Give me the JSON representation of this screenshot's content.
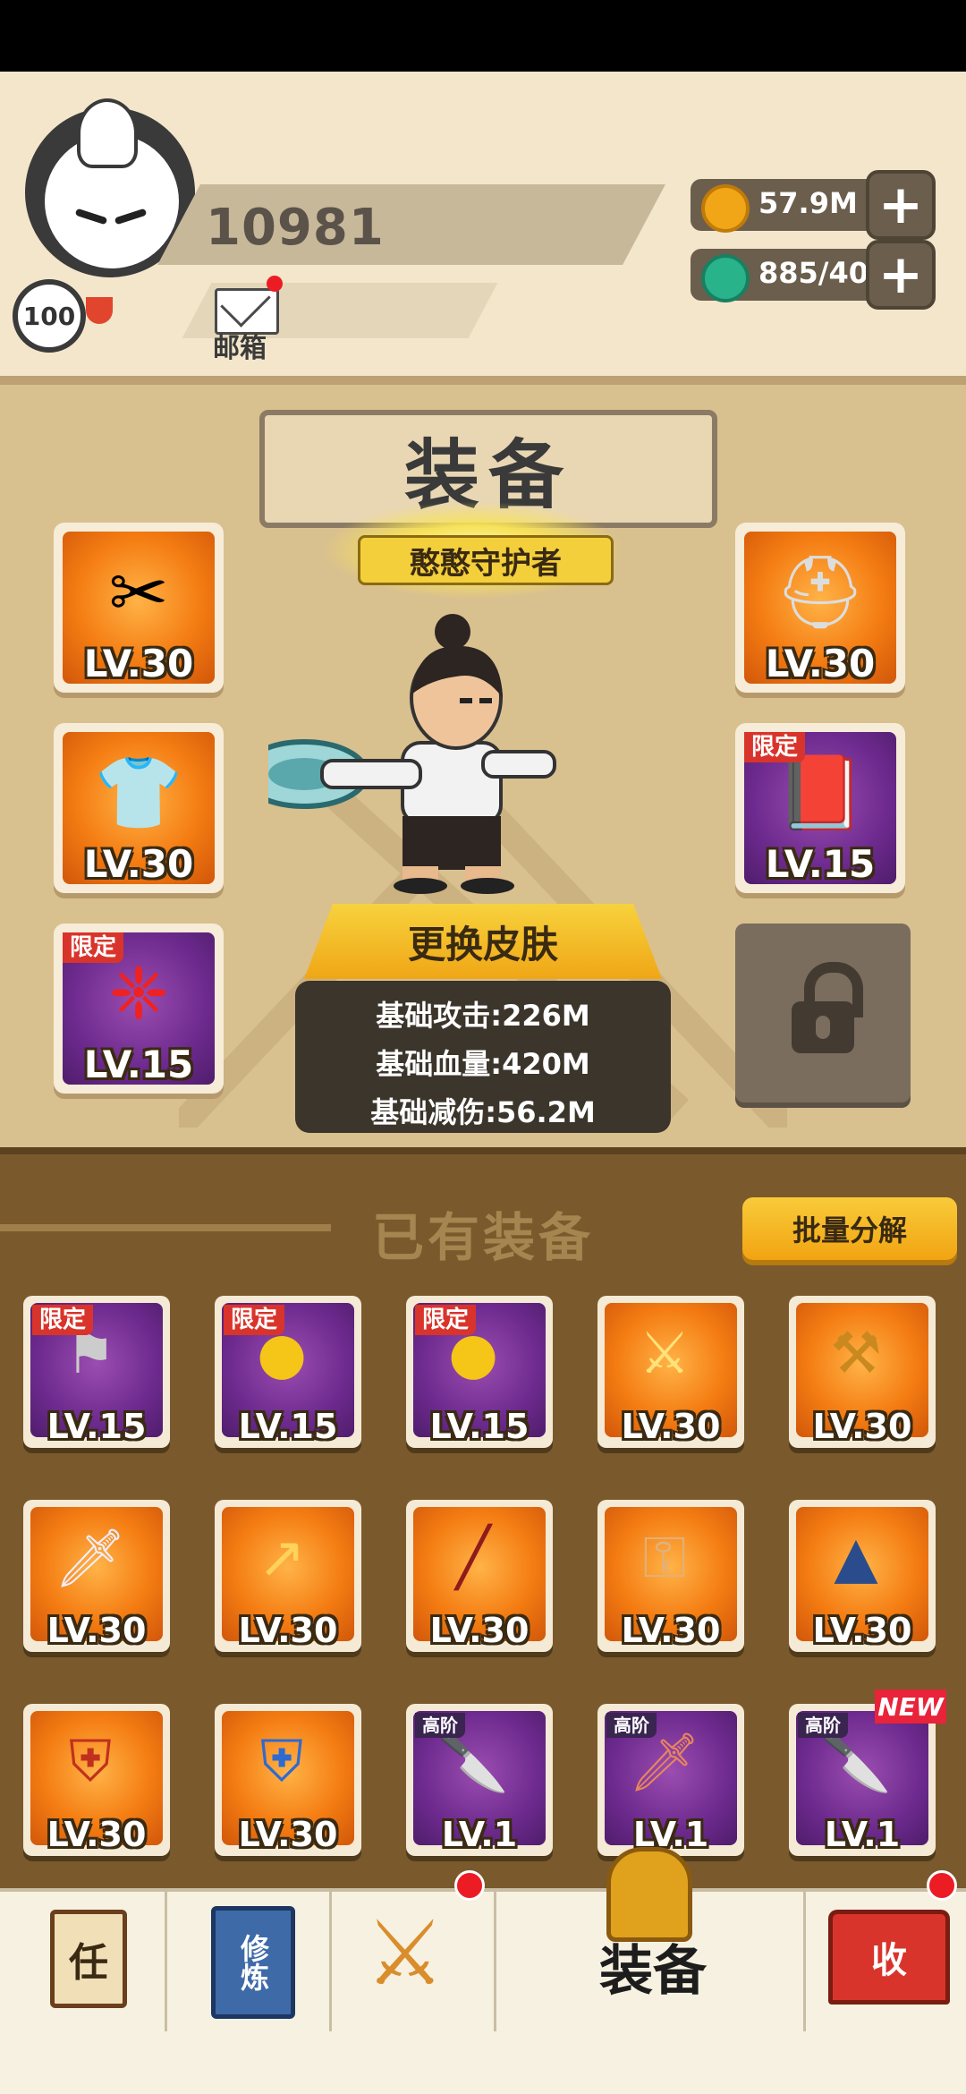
{
  "player": {
    "level": "100",
    "score": "10981",
    "mail_label": "邮箱"
  },
  "resources": [
    {
      "icon": "gold-coin-icon",
      "value": "57.9M",
      "color": "#f0a616"
    },
    {
      "icon": "jade-gem-icon",
      "value": "885/40",
      "color": "#28b38a"
    }
  ],
  "equipment": {
    "title": "装备",
    "character_title": "憨憨守护者",
    "change_skin_label": "更换皮肤",
    "stats": [
      "基础攻击:226M",
      "基础血量:420M",
      "基础减伤:56.2M"
    ],
    "slots_left": [
      {
        "icon": "scissors-icon",
        "level": "LV.30",
        "rarity": "orange",
        "tag": ""
      },
      {
        "icon": "hoodie-icon",
        "level": "LV.30",
        "rarity": "orange",
        "tag": ""
      },
      {
        "icon": "chinese-knot-icon",
        "level": "LV.15",
        "rarity": "purple",
        "tag": "限定"
      }
    ],
    "slots_right": [
      {
        "icon": "helmet-icon",
        "level": "LV.30",
        "rarity": "orange",
        "tag": ""
      },
      {
        "icon": "book-icon",
        "level": "LV.15",
        "rarity": "purple",
        "tag": "限定"
      }
    ]
  },
  "owned": {
    "title": "已有装备",
    "batch_button": "批量分解",
    "items": [
      {
        "icon": "banner-icon",
        "level": "LV.15",
        "rarity": "purple",
        "tag": "限定",
        "new": false
      },
      {
        "icon": "gold-ingot-icon",
        "level": "LV.15",
        "rarity": "purple",
        "tag": "限定",
        "new": false
      },
      {
        "icon": "gold-ingot-icon",
        "level": "LV.15",
        "rarity": "purple",
        "tag": "限定",
        "new": false
      },
      {
        "icon": "golden-sword-icon",
        "level": "LV.30",
        "rarity": "orange",
        "tag": "",
        "new": false
      },
      {
        "icon": "mace-icon",
        "level": "LV.30",
        "rarity": "orange",
        "tag": "",
        "new": false
      },
      {
        "icon": "sword-icon",
        "level": "LV.30",
        "rarity": "orange",
        "tag": "",
        "new": false
      },
      {
        "icon": "spear-icon",
        "level": "LV.30",
        "rarity": "orange",
        "tag": "",
        "new": false
      },
      {
        "icon": "staff-icon",
        "level": "LV.30",
        "rarity": "orange",
        "tag": "",
        "new": false
      },
      {
        "icon": "key-weapon-icon",
        "level": "LV.30",
        "rarity": "orange",
        "tag": "",
        "new": false
      },
      {
        "icon": "straw-hat-icon",
        "level": "LV.30",
        "rarity": "orange",
        "tag": "",
        "new": false
      },
      {
        "icon": "red-armor-icon",
        "level": "LV.30",
        "rarity": "orange",
        "tag": "",
        "new": false
      },
      {
        "icon": "blue-armor-icon",
        "level": "LV.30",
        "rarity": "orange",
        "tag": "",
        "new": false
      },
      {
        "icon": "machete-icon",
        "level": "LV.1",
        "rarity": "purple",
        "tag": "高阶",
        "new": false
      },
      {
        "icon": "red-sword-icon",
        "level": "LV.1",
        "rarity": "purple",
        "tag": "高阶",
        "new": false
      },
      {
        "icon": "blue-machete-icon",
        "level": "LV.1",
        "rarity": "purple",
        "tag": "高阶",
        "new": true
      }
    ],
    "new_label": "NEW"
  },
  "nav": {
    "task_label": "任",
    "train_label": "修炼",
    "equip_label": "装备",
    "shop_label": "收"
  }
}
